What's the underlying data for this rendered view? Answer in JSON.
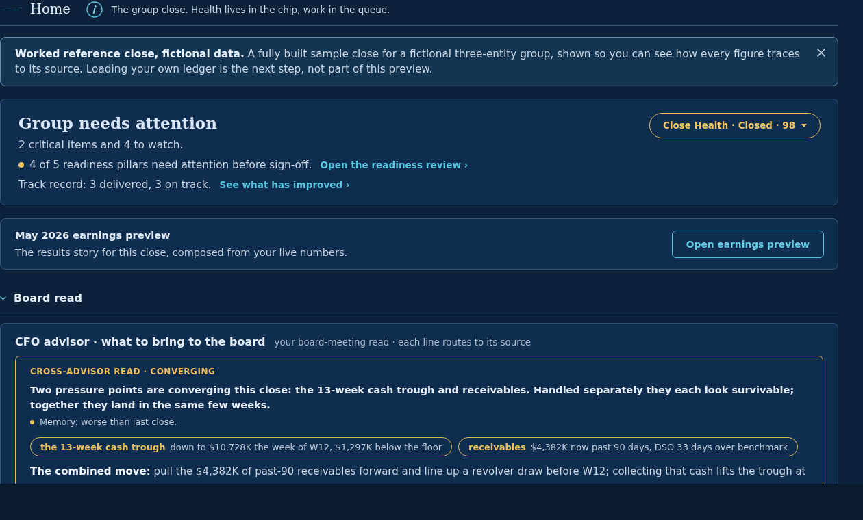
{
  "header": {
    "title": "Home",
    "subtitle": "The group close. Health lives in the chip, work in the queue."
  },
  "notice": {
    "text": "**Worked reference close, fictional data.** A fully built sample close for a fictional three-entity group, shown so you can see how every figure traces to its source. Loading your own ledger is the next step, not part of this preview.",
    "dismissible": true
  },
  "status_card": {
    "title": "Group needs attention",
    "summary": "2 critical items and 4 to watch.",
    "lines": [
      {
        "kind": "alert",
        "text": "4 of 5 readiness pillars need attention before sign-off.",
        "link": "Open the readiness review ›"
      },
      {
        "kind": "plain",
        "text": "Track record: 3 delivered, 3 on track.",
        "link": "See what has improved ›"
      }
    ],
    "chip": {
      "label": "Close Health · Closed · 98"
    }
  },
  "earnings_card": {
    "title": "May 2026 earnings preview",
    "description": "The results story for this close, composed from your live numbers.",
    "button": "Open earnings preview"
  },
  "section": {
    "title": "Board read",
    "expanded": true,
    "advisor": {
      "title": "CFO advisor · what to bring to the board",
      "subtitle": "your board-meeting read · each line routes to its source",
      "read": {
        "eyebrow": "CROSS-ADVISOR READ · CONVERGING",
        "headline": "Two pressure points are converging this close: the 13-week cash trough and receivables. Handled separately they each look survivable; together they land in the same few weeks.",
        "memory": "Memory: worse than last close.",
        "signals": [
          {
            "label": "the 13-week cash trough",
            "detail": "down to $10,728K the week of W12, $1,297K below the floor"
          },
          {
            "label": "receivables",
            "detail": "$4,382K now past 90 days, DSO 33 days over benchmark"
          }
        ],
        "move": "**The combined move:** pull the $4,382K of past-90 receivables forward and line up a revolver draw before W12; collecting that cash lifts the trough at"
      }
    }
  }
}
